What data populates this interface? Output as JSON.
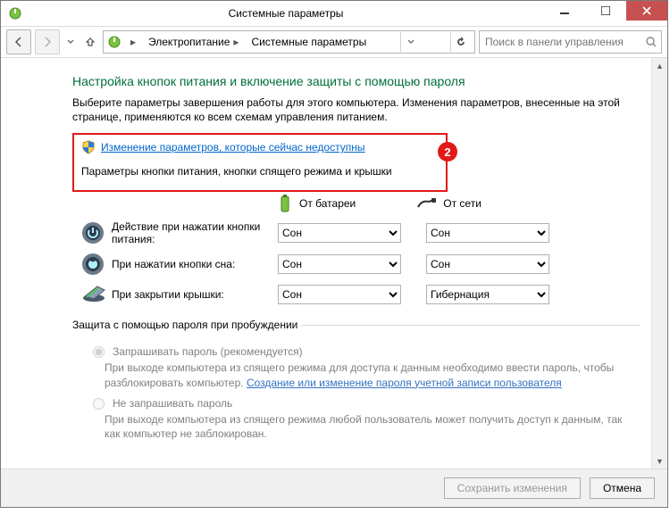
{
  "window": {
    "title": "Системные параметры"
  },
  "breadcrumb": {
    "item1": "Электропитание",
    "item2": "Системные параметры"
  },
  "search": {
    "placeholder": "Поиск в панели управления"
  },
  "heading": "Настройка кнопок питания и включение защиты с помощью пароля",
  "intro": "Выберите параметры завершения работы для этого компьютера. Изменения параметров, внесенные на этой странице, применяются ко всем схемам управления питанием.",
  "admin_link": "Изменение параметров, которые сейчас недоступны",
  "badge": "2",
  "subheading": "Параметры кнопки питания, кнопки спящего режима и крышки",
  "cols": {
    "battery": "От батареи",
    "ac": "От сети"
  },
  "rows": {
    "power": {
      "label": "Действие при нажатии кнопки питания:",
      "battery": "Сон",
      "ac": "Сон"
    },
    "sleep": {
      "label": "При нажатии кнопки сна:",
      "battery": "Сон",
      "ac": "Сон"
    },
    "lid": {
      "label": "При закрытии крышки:",
      "battery": "Сон",
      "ac": "Гибернация"
    }
  },
  "fieldset": {
    "legend": "Защита с помощью пароля при пробуждении",
    "opt1": {
      "label": "Запрашивать пароль (рекомендуется)",
      "desc1": "При выходе компьютера из спящего режима для доступа к данным необходимо ввести пароль, чтобы разблокировать компьютер. ",
      "link": "Создание или изменение пароля учетной записи пользователя"
    },
    "opt2": {
      "label": "Не запрашивать пароль",
      "desc": "При выходе компьютера из спящего режима любой пользователь может получить доступ к данным, так как компьютер не заблокирован."
    }
  },
  "footer": {
    "save": "Сохранить изменения",
    "cancel": "Отмена"
  }
}
